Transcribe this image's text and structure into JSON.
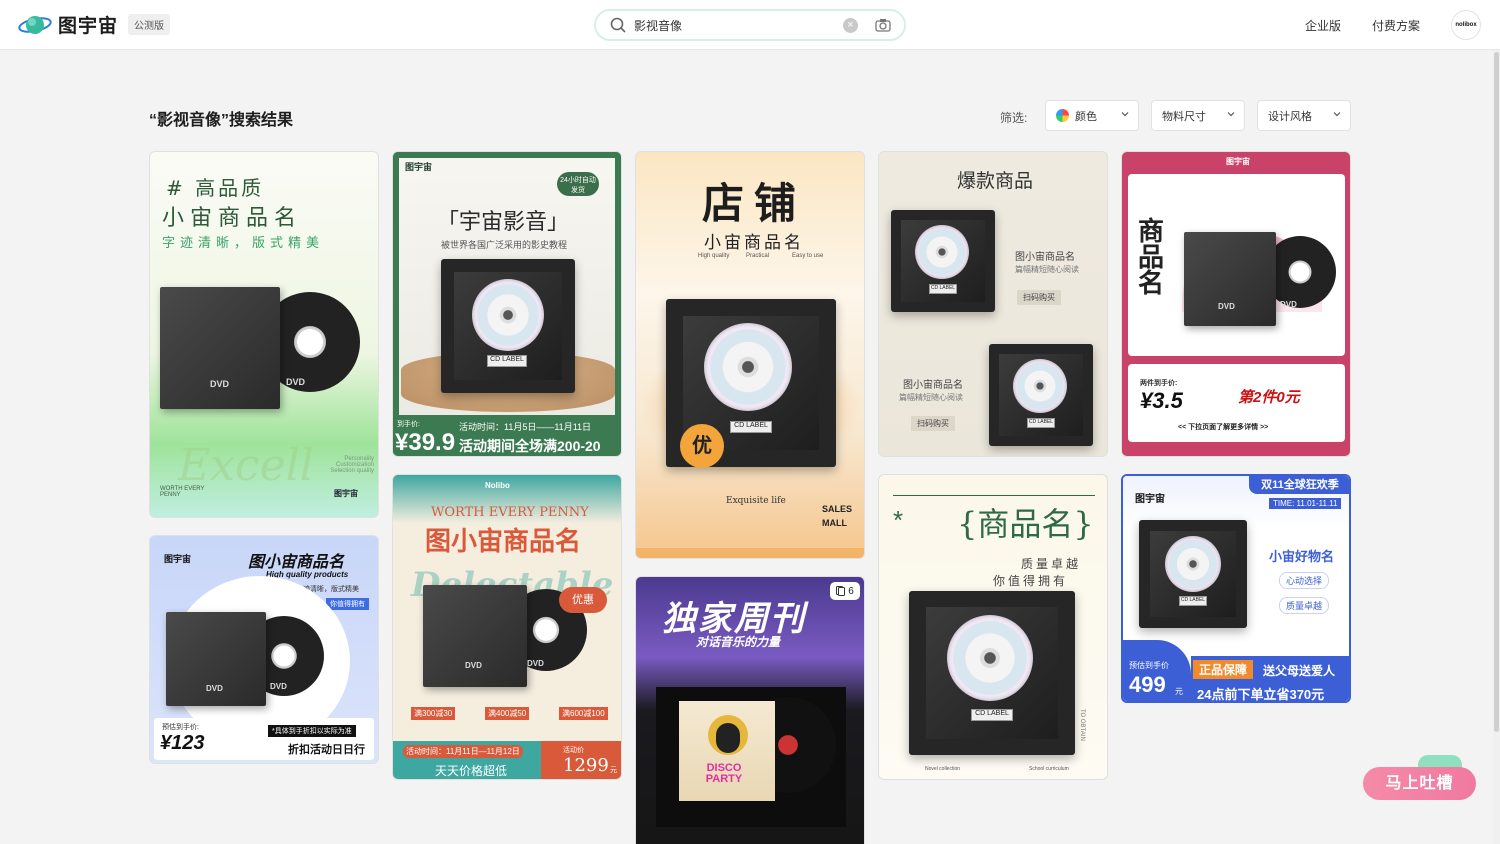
{
  "header": {
    "logo_text": "图宇宙",
    "beta_badge": "公测版",
    "search_value": "影视音像",
    "links": [
      "企业版",
      "付费方案"
    ],
    "avatar_text": "nolibox"
  },
  "results": {
    "title": "“影视音像”搜索结果",
    "filter_label": "筛选:",
    "filters": [
      "颜色",
      "物料尺寸",
      "设计风格"
    ]
  },
  "cards": {
    "c1": {
      "tag": "# 高品质",
      "title": "小宙商品名",
      "sub": "字迹清晰，版式精美",
      "script": "Excell",
      "small": "Personality Customization Selection quality",
      "worth": "WORTH EVERY PENNY",
      "brand": "图宇宙"
    },
    "c2": {
      "brand": "图宇宙",
      "badge": "24小时自动发货",
      "title": "「宇宙影音」",
      "sub": "被世界各国广泛采用的影史教程",
      "price_label": "到手价:",
      "price": "¥39.9",
      "activity": "活动时间：11月5日——11月11日",
      "promo": "活动期间全场满200-20"
    },
    "c3": {
      "title": "店铺",
      "name": "小宙商品名",
      "tags": [
        "High quality",
        "Practical",
        "Easy to use"
      ],
      "seal": "优",
      "foot": "Exquisite life",
      "mall": "SALES MALL"
    },
    "c4": {
      "title": "爆款商品",
      "n1": "图小宙商品名",
      "d1": "篇幅精短随心阅读",
      "buy1": "扫码购买",
      "n2": "图小宙商品名",
      "d2": "篇幅精短随心阅读",
      "buy2": "扫码购买"
    },
    "c5": {
      "brand": "图宇宙",
      "vertical": "商品名",
      "price_label": "两件到手价:",
      "price": "¥3.5",
      "promo": "第2件0元",
      "foot": "<< 下拉页面了解更多详情 >>"
    },
    "c6": {
      "brand": "图宇宙",
      "title": "图小宙商品名",
      "sub1": "High quality products",
      "sub2": "字迹清晰，版式精美",
      "tag": "你值得拥有",
      "price_label": "预估到手价:",
      "price": "¥123",
      "note": "*具体到手折扣以实际为准",
      "promo": "折扣活动日日行"
    },
    "c7": {
      "brand": "Nolibo",
      "en": "WORTH EVERY PENNY",
      "title": "图小宙商品名",
      "script": "Delectable",
      "badge": "优惠",
      "coupons": [
        "满300减30",
        "满400减50",
        "满600减100"
      ],
      "time": "活动时间：11月11日—11月12日",
      "slogan": "天天价格超低",
      "price_label": "活动价",
      "price": "1299",
      "unit": "元"
    },
    "c8": {
      "title": "独家周刊",
      "sub": "对话音乐的力量",
      "count": "6",
      "album": "DISCO PARTY"
    },
    "c9": {
      "title": "{商品名}",
      "star": "*",
      "line1": "质量卓越",
      "line2": "你值得拥有",
      "side": "TO OBTAIN",
      "foot1": "Novel collection",
      "foot2": "School curriculum"
    },
    "c10": {
      "brand": "图宇宙",
      "ribbon": "双11全球狂欢季",
      "time": "TIME: 11.01-11.11",
      "title": "小宙好物名",
      "b1": "心动选择",
      "b2": "质量卓越",
      "price_label": "预估到手价",
      "price": "499",
      "unit": "元",
      "guarantee": "正品保障",
      "gift": "送父母送爱人",
      "promo": "24点前下单立省370元"
    }
  },
  "feedback": "马上吐槽"
}
